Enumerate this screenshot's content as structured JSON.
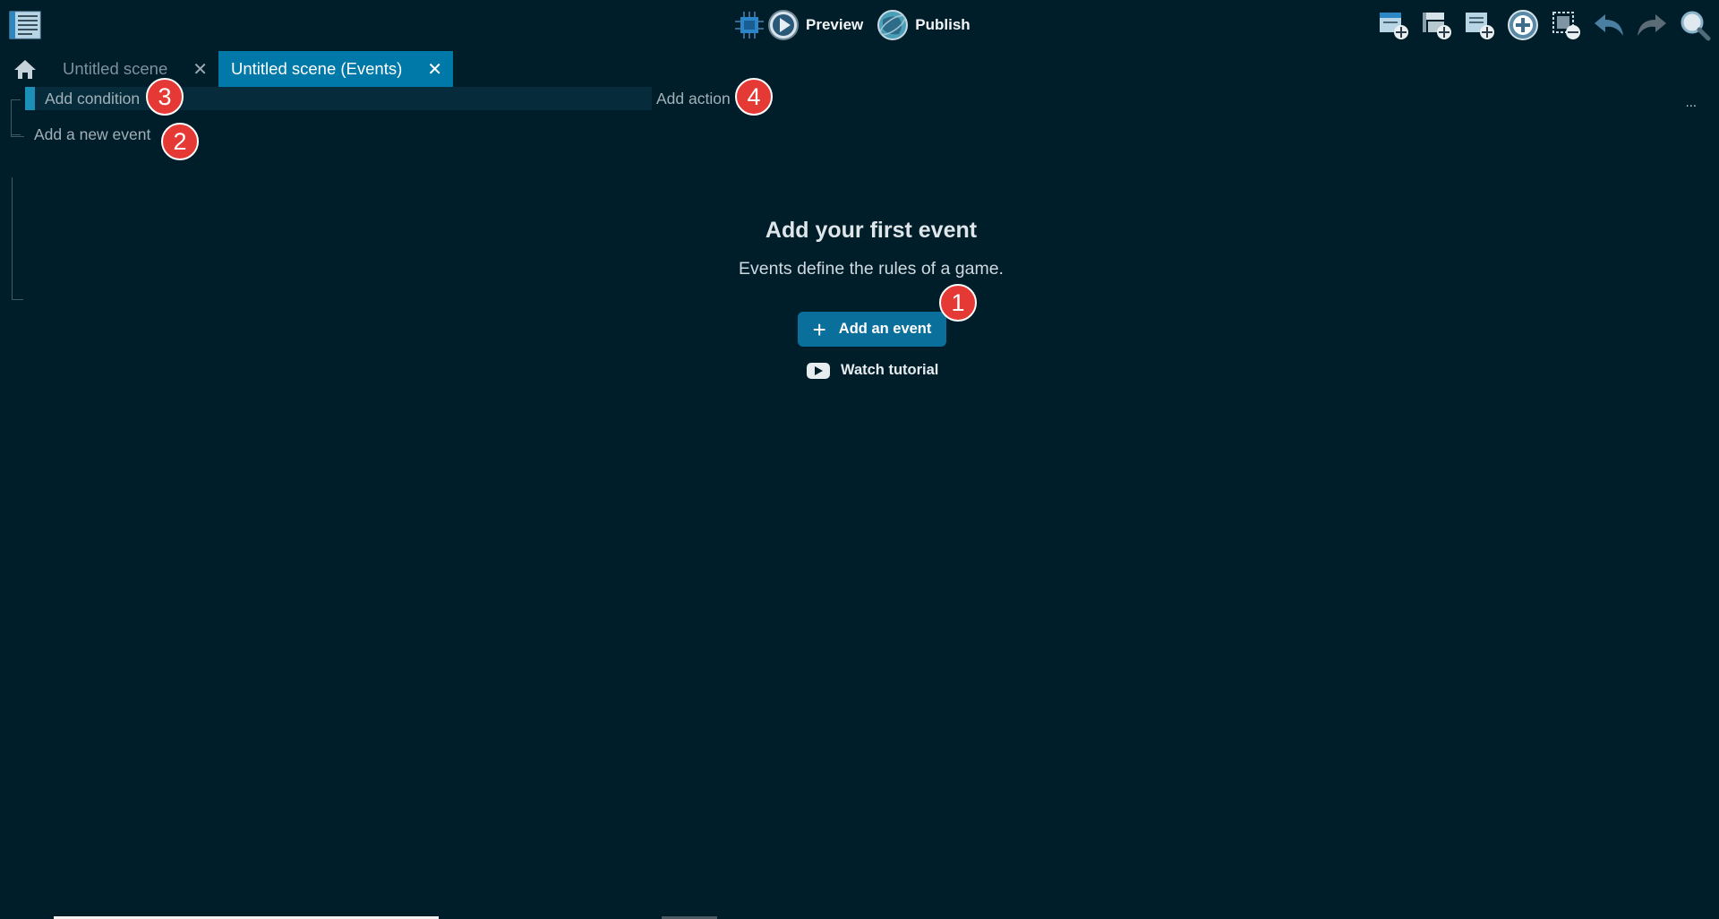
{
  "toolbar": {
    "menu_icon": "events-list-icon",
    "preview_label": "Preview",
    "publish_label": "Publish",
    "right_icons": [
      "add-event-icon",
      "add-subevent-icon",
      "add-comment-icon",
      "add-other-icon",
      "delete-selection-icon",
      "undo-icon",
      "redo-icon",
      "search-icon"
    ]
  },
  "tabs": [
    {
      "label": "Untitled scene",
      "active": false
    },
    {
      "label": "Untitled scene (Events)",
      "active": true
    }
  ],
  "events": {
    "add_condition": "Add condition",
    "add_action": "Add action",
    "add_new_event": "Add a new event",
    "more": "..."
  },
  "empty_state": {
    "title": "Add your first event",
    "subtitle": "Events define the rules of a game.",
    "button": "Add an event",
    "tutorial": "Watch tutorial"
  },
  "badges": [
    "1",
    "2",
    "3",
    "4"
  ],
  "colors": {
    "background": "#001e2a",
    "accent": "#0079a8",
    "badge": "#e53935"
  }
}
